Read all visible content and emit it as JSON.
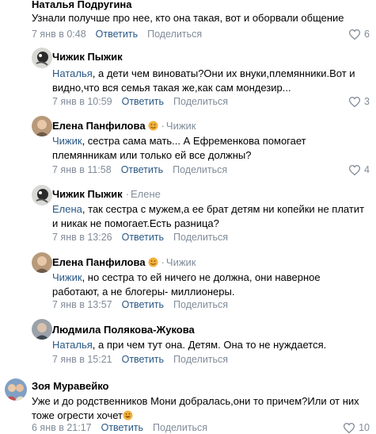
{
  "comments": [
    {
      "author": "Наталья Подругина",
      "text": "Узнали получше про нее, кто она такая, вот и оборвали общение",
      "date": "7 янв в 0:48",
      "reply_label": "Ответить",
      "share_label": "Поделиться",
      "likes": "6"
    },
    {
      "author": "Чижик Пыжик",
      "mention": "Наталья",
      "text": ", а дети чем виноваты?Они их внуки,племянники.Вот и видно,что вся семья такая же,как сам мондезир...",
      "date": "7 янв в 10:59",
      "reply_label": "Ответить",
      "share_label": "Поделиться",
      "likes": "3"
    },
    {
      "author": "Елена Панфилова",
      "reply_to": "Чижик",
      "mention": "Чижик",
      "text": ", сестра сама мать... А Ефременкова помогает племянникам или только ей все должны?",
      "date": "7 янв в 11:58",
      "reply_label": "Ответить",
      "share_label": "Поделиться",
      "likes": "4"
    },
    {
      "author": "Чижик Пыжик",
      "reply_to": "Елене",
      "mention": "Елена",
      "text": ", так сестра с мужем,а ее брат детям ни копейки не платит и никак не помогает.Есть разница?",
      "date": "7 янв в 13:26",
      "reply_label": "Ответить",
      "share_label": "Поделиться"
    },
    {
      "author": "Елена Панфилова",
      "reply_to": "Чижик",
      "mention": "Чижик",
      "text": ", но сестра то ей ничего не должна, они наверное работают, а не блогеры- миллионеры.",
      "date": "7 янв в 13:57",
      "reply_label": "Ответить",
      "share_label": "Поделиться"
    },
    {
      "author": "Людмила Полякова-Жукова",
      "mention": "Наталья",
      "text": ", а при чем тут она. Детям. Она то не нуждается.",
      "date": "7 янв в 15:21",
      "reply_label": "Ответить",
      "share_label": "Поделиться"
    },
    {
      "author": "Зоя Муравейко",
      "text": "Уже и до родственников Мони добралась,они то причем?Или от них тоже огрести хочет",
      "date": "6 янв в 21:17",
      "reply_label": "Ответить",
      "share_label": "Поделиться",
      "likes": "10"
    }
  ],
  "icons": {
    "like": "heart-icon",
    "status": "smile-emoji-icon"
  },
  "colors": {
    "link": "#2a5885",
    "secondary": "#818c99"
  }
}
